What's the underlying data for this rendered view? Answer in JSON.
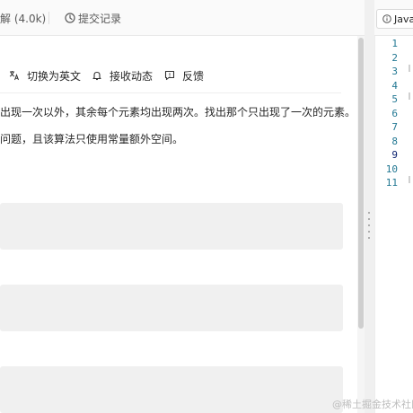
{
  "tabs": {
    "solutions_label": "解 (4.0k)",
    "submissions_label": "提交记录"
  },
  "toolbar": {
    "switch_lang_label": "切换为英文",
    "subscribe_label": "接收动态",
    "feedback_label": "反馈"
  },
  "description": {
    "line1": "出现一次以外，其余每个元素均出现两次。找出那个只出现了一次的元素。",
    "line2": "问题，且该算法只使用常量额外空间。"
  },
  "editor": {
    "language_label": "JavaS",
    "line_numbers": [
      "1",
      "2",
      "3",
      "4",
      "5",
      "6",
      "7",
      "8",
      "9",
      "10",
      "11"
    ]
  },
  "watermark": "@稀土掘金技术社区",
  "colors": {
    "line_number": "#237893",
    "active_line_number": "#0b216f",
    "block_background": "#f0f0f0"
  }
}
